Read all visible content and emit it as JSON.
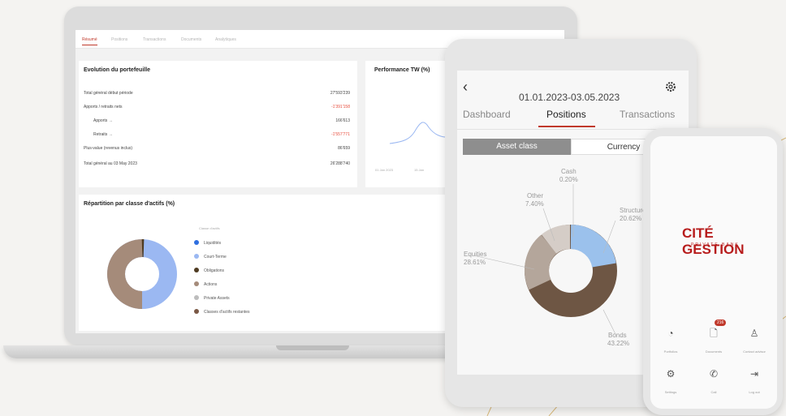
{
  "laptop": {
    "tabs": [
      "Résumé",
      "Positions",
      "Transactions",
      "Documents",
      "Analytiques"
    ],
    "evolution": {
      "title": "Evolution du portefeuille",
      "rows": [
        {
          "label": "Total général début période",
          "value": "27'593'239",
          "red": false
        },
        {
          "label": "Apports / retraits nets",
          "value": "-1'391'158",
          "red": true
        },
        {
          "label": "Apports →",
          "value": "166'613",
          "red": false
        },
        {
          "label": "Retraits →",
          "value": "-1'557'771",
          "red": true
        },
        {
          "label": "Plus-value (revenus inclus)",
          "value": "86'659",
          "red": false
        },
        {
          "label": "Total général au 03 May 2023",
          "value": "26'288'740",
          "red": false
        }
      ]
    },
    "performance": {
      "title": "Performance TW (%)",
      "x_labels": [
        "01 Jan 2023",
        "15 Jan"
      ]
    },
    "repartition": {
      "title": "Répartition par classe d'actifs (%)",
      "legend_header": "Classe d'actifs",
      "legend": [
        {
          "label": "Liquidités",
          "color": "#2f6fe0"
        },
        {
          "label": "Court-Terme",
          "color": "#9bb8f2"
        },
        {
          "label": "Obligations",
          "color": "#4e3b22"
        },
        {
          "label": "Actions",
          "color": "#a58b7a"
        },
        {
          "label": "Private Assets",
          "color": "#bdbdbd"
        },
        {
          "label": "Classes d'actifs restantes",
          "color": "#7a5845"
        }
      ]
    }
  },
  "tablet": {
    "back_icon": "chevron-left-icon",
    "settings_icon": "gear-icon",
    "date_range": "01.01.2023-03.05.2023",
    "tabs": [
      "Dashboard",
      "Positions",
      "Transactions"
    ],
    "active_tab": "Positions",
    "segment": [
      "Asset class",
      "Currency"
    ],
    "donut_labels": [
      {
        "name": "Cash",
        "value": "0.20%"
      },
      {
        "name": "Other",
        "value": "7.40%"
      },
      {
        "name": "Structured",
        "value": "20.62%"
      },
      {
        "name": "Equities",
        "value": "28.61%"
      },
      {
        "name": "Bonds",
        "value": "43.22%"
      }
    ]
  },
  "phone": {
    "logo_main": "CITÉ GESTION",
    "logo_sub": "PRIVATE BANK",
    "badge": "216",
    "icons": [
      {
        "icon": "pie-chart-icon",
        "label": "Portfolios"
      },
      {
        "icon": "document-icon",
        "label": "Documents"
      },
      {
        "icon": "advisor-icon",
        "label": "Contact advisor"
      },
      {
        "icon": "settings-icon",
        "label": "Settings"
      },
      {
        "icon": "phone-icon",
        "label": "Call"
      },
      {
        "icon": "logout-icon",
        "label": "Log out"
      }
    ]
  }
}
